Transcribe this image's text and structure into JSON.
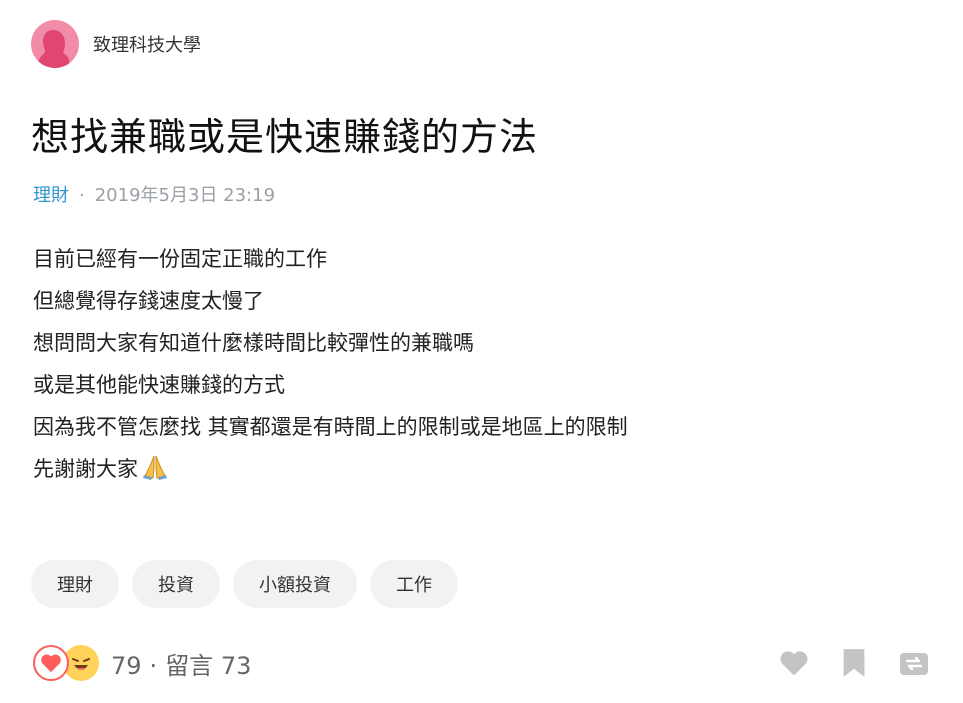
{
  "author": {
    "name": "致理科技大學",
    "avatar_icon": "female-silhouette-avatar"
  },
  "post": {
    "title": "想找兼職或是快速賺錢的方法",
    "category": "理財",
    "datetime": "2019年5月3日 23:19",
    "meta_separator": "·",
    "lines": [
      "目前已經有一份固定正職的工作",
      "但總覺得存錢速度太慢了",
      "想問問大家有知道什麼樣時間比較彈性的兼職嗎",
      "或是其他能快速賺錢的方式",
      "因為我不管怎麼找 其實都還是有時間上的限制或是地區上的限制",
      "先謝謝大家"
    ],
    "closing_emoji": "folded-hands-emoji"
  },
  "tags": [
    "理財",
    "投資",
    "小額投資",
    "工作"
  ],
  "footer": {
    "reaction_count": "79",
    "separator": "·",
    "comments_label": "留言 73",
    "reaction_icons": [
      "heart-reaction-icon",
      "laughing-reaction-icon"
    ],
    "action_icons": [
      "like-heart-icon",
      "bookmark-icon",
      "share-icon"
    ]
  },
  "colors": {
    "category": "#3397cf",
    "tag_bg": "#f1f2f3",
    "heart": "#ff5c5c",
    "avatar_bg": "#f28ba8"
  }
}
